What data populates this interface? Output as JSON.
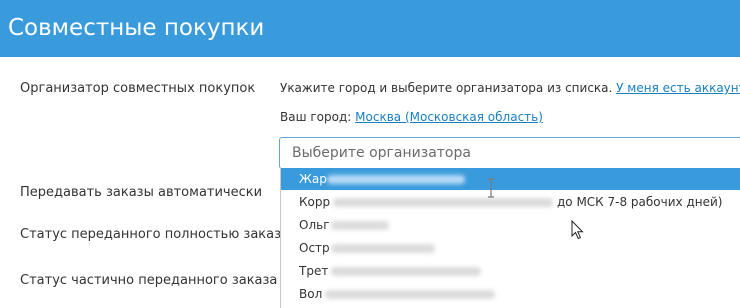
{
  "header": {
    "title": "Совместные покупки"
  },
  "form": {
    "organizer_label": "Организатор совместных покупок",
    "auto_label": "Передавать заказы автоматически",
    "status_full_label": "Статус переданного полностью заказа",
    "status_partial_label": "Статус частично переданного заказа"
  },
  "organizer": {
    "instruction": "Укажите город и выберите организатора из списка.",
    "account_link": "У меня есть аккаунт.",
    "city_label": "Ваш город:",
    "city_link": "Москва (Московская область)",
    "select_placeholder": "Выберите организатора"
  },
  "dropdown": {
    "items": [
      {
        "text": "Жар",
        "tail": ""
      },
      {
        "text": "Корр",
        "tail": "до МСК 7-8 рабочих дней)"
      },
      {
        "text": "Ольг",
        "tail": ""
      },
      {
        "text": "Остр",
        "tail": ""
      },
      {
        "text": "Трет",
        "tail": ""
      },
      {
        "text": "Вол",
        "tail": ""
      }
    ]
  },
  "colors": {
    "header_bg": "#3a9bdc",
    "link": "#1a7fc0",
    "highlight_bg": "#3a9bdc"
  },
  "icons": {
    "cursor": "mouse-pointer-icon",
    "text_cursor": "text-cursor-icon"
  }
}
